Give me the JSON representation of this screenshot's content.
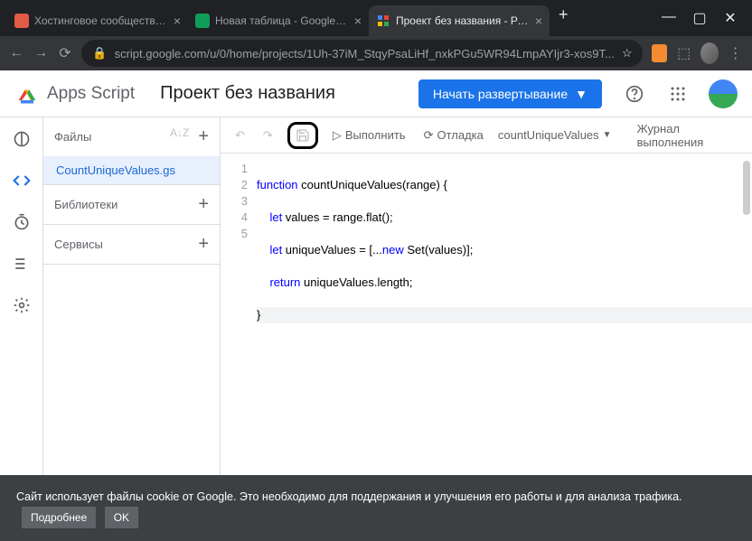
{
  "browser": {
    "tabs": [
      {
        "title": "Хостинговое сообщество «Tim",
        "favicon": "#e25b45"
      },
      {
        "title": "Новая таблица - Google Табли",
        "favicon": "#0f9d58"
      },
      {
        "title": "Проект без названия - Редакт",
        "favicon": "multi",
        "active": true
      }
    ],
    "url": "script.google.com/u/0/home/projects/1Uh-37iM_StqyPsaLiHf_nxkPGu5WR94LmpAYIjr3-xos9T..."
  },
  "app": {
    "brand": "Apps Script",
    "project_name": "Проект без названия",
    "deploy_label": "Начать развертывание"
  },
  "sidebar": {
    "files_label": "Файлы",
    "file_name": "CountUniqueValues.gs",
    "libraries_label": "Библиотеки",
    "services_label": "Сервисы"
  },
  "editor_toolbar": {
    "run_label": "Выполнить",
    "debug_label": "Отладка",
    "function_name": "countUniqueValues",
    "log_label": "Журнал выполнения"
  },
  "code": {
    "lines": [
      "1",
      "2",
      "3",
      "4",
      "5"
    ],
    "l1a": "function",
    "l1b": " countUniqueValues(range) ",
    "l1c": "{",
    "l2a": "    let",
    "l2b": " values = range.flat();",
    "l3a": "    let",
    "l3b": " uniqueValues = [...",
    "l3c": "new",
    "l3d": " Set(values)];",
    "l4a": "    return",
    "l4b": " uniqueValues.length;",
    "l5": "}"
  },
  "cookie": {
    "text": "Сайт использует файлы cookie от Google. Это необходимо для поддержания и улучшения его работы и для анализа трафика.",
    "more": "Подробнее",
    "ok": "OK"
  }
}
